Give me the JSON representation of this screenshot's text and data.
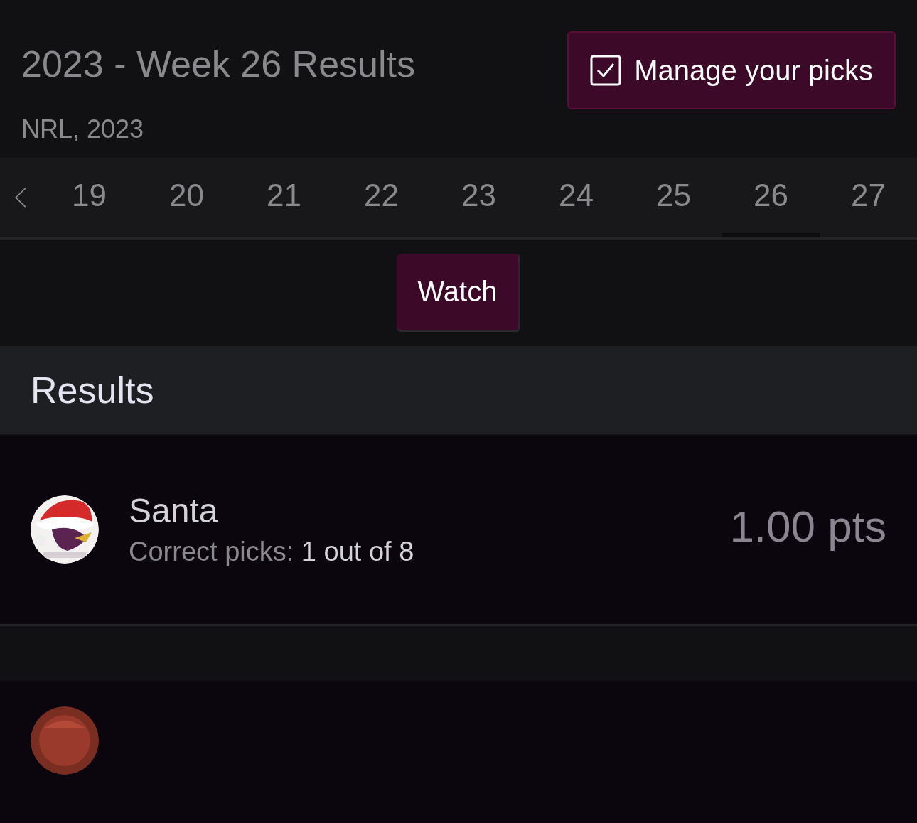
{
  "header": {
    "title": "2023 - Week 26 Results",
    "subtitle": "NRL, 2023",
    "manage_button": "Manage your picks"
  },
  "weeks": [
    {
      "label": "19",
      "selected": false
    },
    {
      "label": "20",
      "selected": false
    },
    {
      "label": "21",
      "selected": false
    },
    {
      "label": "22",
      "selected": false
    },
    {
      "label": "23",
      "selected": false
    },
    {
      "label": "24",
      "selected": false
    },
    {
      "label": "25",
      "selected": false
    },
    {
      "label": "26",
      "selected": true
    },
    {
      "label": "27",
      "selected": false
    }
  ],
  "watch_button": "Watch",
  "results": {
    "heading": "Results",
    "entries": [
      {
        "avatar": {
          "kind": "picture"
        },
        "name": "Santa",
        "picks_label": "Correct picks:",
        "picks_value": "1 out of 8",
        "points": "1.00 pts"
      },
      {
        "avatar": {
          "kind": "picture"
        }
      }
    ]
  }
}
